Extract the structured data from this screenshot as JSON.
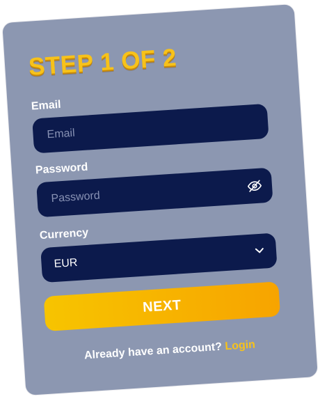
{
  "form": {
    "title": "STEP 1 OF 2",
    "email": {
      "label": "Email",
      "placeholder": "Email",
      "value": ""
    },
    "password": {
      "label": "Password",
      "placeholder": "Password",
      "value": "",
      "toggle_icon": "eye-off-icon"
    },
    "currency": {
      "label": "Currency",
      "selected": "EUR",
      "icon": "chevron-down-icon"
    },
    "next_label": "NEXT",
    "footer_text": "Already have an account?",
    "login_link": "Login"
  },
  "colors": {
    "card_bg": "#8c97b1",
    "field_bg": "#0c1a4c",
    "accent_yellow": "#f7c21a",
    "button_start": "#f7c400",
    "button_end": "#f7a400"
  }
}
